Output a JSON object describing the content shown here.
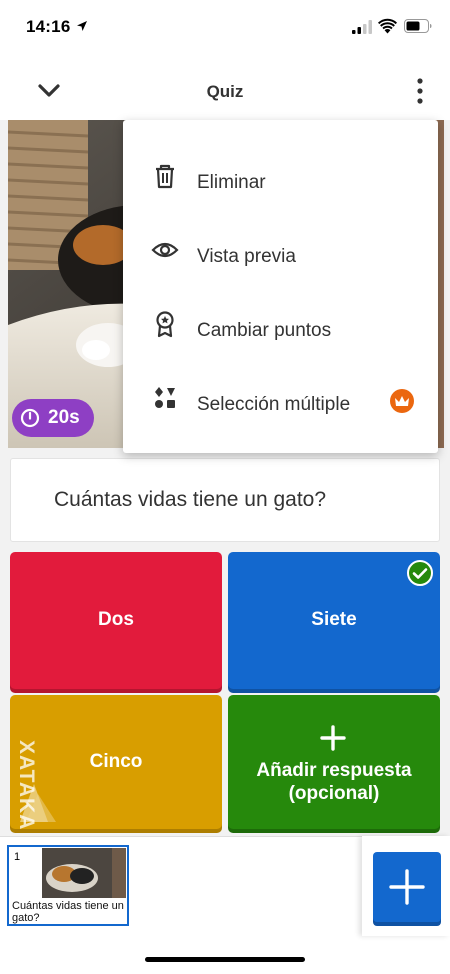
{
  "status_bar": {
    "time": "14:16"
  },
  "header": {
    "title": "Quiz"
  },
  "cover": {
    "timer": "20s"
  },
  "question": {
    "text": "Cuántas vidas tiene un gato?"
  },
  "answers": [
    {
      "label": "Dos",
      "color": "#e21b3c",
      "correct": false
    },
    {
      "label": "Siete",
      "color": "#1368ce",
      "correct": true
    },
    {
      "label": "Cinco",
      "color": "#d89e00",
      "correct": false
    },
    {
      "label": "Añadir respuesta (opcional)",
      "color": "#26890c",
      "is_add": true
    }
  ],
  "menu": {
    "items": [
      {
        "label": "Eliminar",
        "icon": "trash-icon"
      },
      {
        "label": "Vista previa",
        "icon": "eye-icon"
      },
      {
        "label": "Cambiar puntos",
        "icon": "award-icon"
      },
      {
        "label": "Selección múltiple",
        "icon": "grid-dots-icon",
        "premium": true
      }
    ]
  },
  "slides": [
    {
      "number": "1",
      "title": "Cuántas vidas tiene un gato?"
    }
  ],
  "watermark": {
    "text": "XATAKA BASICS"
  },
  "colors": {
    "accent": "#1368ce",
    "timer": "#8e3fc4",
    "premium": "#eb670f"
  }
}
